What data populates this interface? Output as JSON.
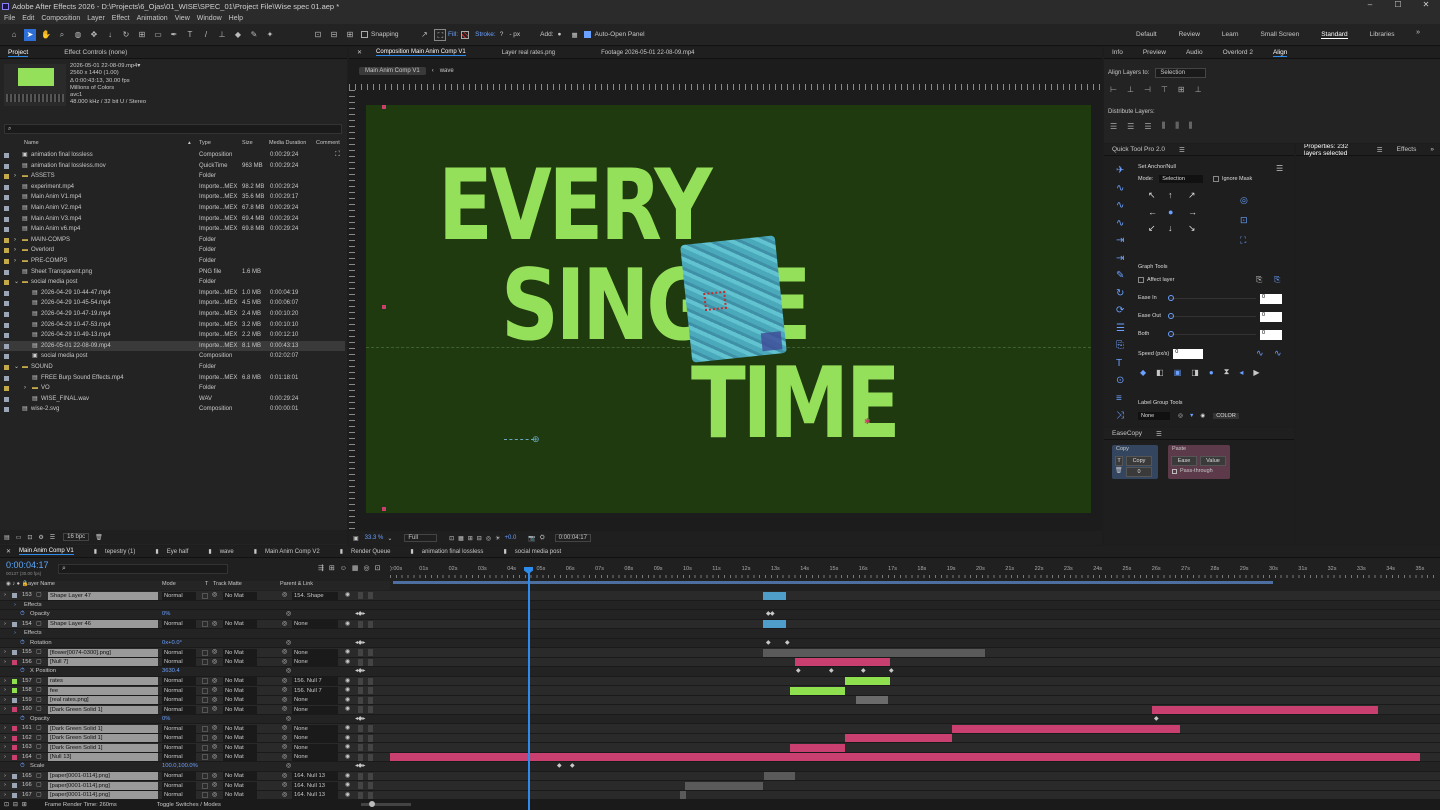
{
  "window": {
    "title": "Adobe After Effects 2026 - D:\\Projects\\6_Ojas\\01_WISE\\SPEC_01\\Project File\\Wise spec 01.aep *",
    "min": "–",
    "max": "☐",
    "close": "✕"
  },
  "menu": [
    "File",
    "Edit",
    "Composition",
    "Layer",
    "Effect",
    "Animation",
    "View",
    "Window",
    "Help"
  ],
  "toolbar": {
    "snapping": "Snapping",
    "fill": "Fill:",
    "stroke": "Stroke:",
    "stroke_px": "- px",
    "add": "Add:",
    "auto_open": "Auto-Open Panel",
    "workspaces": [
      "Default",
      "Review",
      "Learn",
      "Small Screen",
      "Standard",
      "Libraries"
    ],
    "active_workspace": "Standard"
  },
  "project": {
    "tabs": [
      "Project",
      "Effect Controls (none)"
    ],
    "preview": {
      "name": "2026-05-01 22-08-09.mp4▾",
      "res": "2560 x 1440 (1.00)",
      "dur": "Δ 0:00:43:13, 30.00 fps",
      "colors": "Millions of Colors",
      "codec": "avc1",
      "audio": "48.000 kHz / 32 bit U / Stereo"
    },
    "search_placeholder": "",
    "columns": [
      "Name",
      "Type",
      "Size",
      "Media Duration",
      "Comment"
    ],
    "items": [
      {
        "indent": 0,
        "arrow": "",
        "icon": "comp",
        "name": "animation final lossless",
        "type": "Composition",
        "size": "",
        "dur": "0:00:29:24",
        "label": "#9aa6b5"
      },
      {
        "indent": 0,
        "arrow": "",
        "icon": "file",
        "name": "animation final lossless.mov",
        "type": "QuickTime",
        "size": "963 MB",
        "dur": "0:00:29:24",
        "label": "#9aa6b5"
      },
      {
        "indent": 0,
        "arrow": "›",
        "icon": "folder",
        "name": "ASSETS",
        "type": "Folder",
        "size": "",
        "dur": "",
        "label": "#c4a94b"
      },
      {
        "indent": 0,
        "arrow": "",
        "icon": "file",
        "name": "experiment.mp4",
        "type": "Importe...MEX",
        "size": "98.2 MB",
        "dur": "0:00:29:24",
        "label": "#9aa6b5"
      },
      {
        "indent": 0,
        "arrow": "",
        "icon": "file",
        "name": "Main Anim V1.mp4",
        "type": "Importe...MEX",
        "size": "35.6 MB",
        "dur": "0:00:29:17",
        "label": "#9aa6b5"
      },
      {
        "indent": 0,
        "arrow": "",
        "icon": "file",
        "name": "Main Anim V2.mp4",
        "type": "Importe...MEX",
        "size": "67.8 MB",
        "dur": "0:00:29:24",
        "label": "#9aa6b5"
      },
      {
        "indent": 0,
        "arrow": "",
        "icon": "file",
        "name": "Main Anim V3.mp4",
        "type": "Importe...MEX",
        "size": "69.4 MB",
        "dur": "0:00:29:24",
        "label": "#9aa6b5"
      },
      {
        "indent": 0,
        "arrow": "",
        "icon": "file",
        "name": "Main Anim v6.mp4",
        "type": "Importe...MEX",
        "size": "69.8 MB",
        "dur": "0:00:29:24",
        "label": "#9aa6b5"
      },
      {
        "indent": 0,
        "arrow": "›",
        "icon": "folder",
        "name": "MAIN-COMPS",
        "type": "Folder",
        "size": "",
        "dur": "",
        "label": "#c4a94b"
      },
      {
        "indent": 0,
        "arrow": "›",
        "icon": "folder",
        "name": "Overlord",
        "type": "Folder",
        "size": "",
        "dur": "",
        "label": "#c4a94b"
      },
      {
        "indent": 0,
        "arrow": "›",
        "icon": "folder",
        "name": "PRE-COMPS",
        "type": "Folder",
        "size": "",
        "dur": "",
        "label": "#c4a94b"
      },
      {
        "indent": 0,
        "arrow": "",
        "icon": "file",
        "name": "Sheet Transparent.png",
        "type": "PNG file",
        "size": "1.6 MB",
        "dur": "",
        "label": "#9aa6b5"
      },
      {
        "indent": 0,
        "arrow": "⌄",
        "icon": "folder",
        "name": "social media post",
        "type": "Folder",
        "size": "",
        "dur": "",
        "label": "#c4a94b"
      },
      {
        "indent": 1,
        "arrow": "",
        "icon": "file",
        "name": "2026-04-29 10-44-47.mp4",
        "type": "Importe...MEX",
        "size": "1.0 MB",
        "dur": "0:00:04:19",
        "label": "#9aa6b5"
      },
      {
        "indent": 1,
        "arrow": "",
        "icon": "file",
        "name": "2026-04-29 10-45-54.mp4",
        "type": "Importe...MEX",
        "size": "4.5 MB",
        "dur": "0:00:06:07",
        "label": "#9aa6b5"
      },
      {
        "indent": 1,
        "arrow": "",
        "icon": "file",
        "name": "2026-04-29 10-47-19.mp4",
        "type": "Importe...MEX",
        "size": "2.4 MB",
        "dur": "0:00:10:20",
        "label": "#9aa6b5"
      },
      {
        "indent": 1,
        "arrow": "",
        "icon": "file",
        "name": "2026-04-29 10-47-53.mp4",
        "type": "Importe...MEX",
        "size": "3.2 MB",
        "dur": "0:00:10:10",
        "label": "#9aa6b5"
      },
      {
        "indent": 1,
        "arrow": "",
        "icon": "file",
        "name": "2026-04-29 10-49-13.mp4",
        "type": "Importe...MEX",
        "size": "2.2 MB",
        "dur": "0:00:12:10",
        "label": "#9aa6b5"
      },
      {
        "indent": 1,
        "arrow": "",
        "icon": "file",
        "name": "2026-05-01 22-08-09.mp4",
        "type": "Importe...MEX",
        "size": "8.1 MB",
        "dur": "0:00:43:13",
        "label": "#9aa6b5",
        "selected": true
      },
      {
        "indent": 1,
        "arrow": "",
        "icon": "comp",
        "name": "social media post",
        "type": "Composition",
        "size": "",
        "dur": "0:02:02:07",
        "label": "#9aa6b5"
      },
      {
        "indent": 0,
        "arrow": "⌄",
        "icon": "folder",
        "name": "SOUND",
        "type": "Folder",
        "size": "",
        "dur": "",
        "label": "#c4a94b"
      },
      {
        "indent": 1,
        "arrow": "",
        "icon": "file",
        "name": "FREE Burp Sound Effects.mp4",
        "type": "Importe...MEX",
        "size": "6.8 MB",
        "dur": "0:01:18:01",
        "label": "#9aa6b5"
      },
      {
        "indent": 1,
        "arrow": "›",
        "icon": "folder",
        "name": "VO",
        "type": "Folder",
        "size": "",
        "dur": "",
        "label": "#c4a94b"
      },
      {
        "indent": 1,
        "arrow": "",
        "icon": "file",
        "name": "WISE_FINAL.wav",
        "type": "WAV",
        "size": "",
        "dur": "0:00:29:24",
        "label": "#9aa6b5"
      },
      {
        "indent": 0,
        "arrow": "",
        "icon": "file",
        "name": "wise-2.svg",
        "type": "Composition",
        "size": "",
        "dur": "0:00:00:01",
        "label": "#9aa6b5"
      }
    ],
    "bpc": "16 bpc"
  },
  "viewer": {
    "tabs": [
      "Composition Main Anim Comp V1",
      "Layer real rates.png",
      "Footage 2026-05-01 22-08-09.mp4"
    ],
    "crumbs": [
      "Main Anim Comp V1",
      "wave"
    ],
    "words": [
      "EVERY",
      "SINGLE",
      "TIME"
    ],
    "canvas_bg": "#1f3a0e",
    "text_color": "#95e05a",
    "card_color": "#53b8c8",
    "zoom": "33.3 %",
    "quality": "Full",
    "plus": "+0.0",
    "timecode": "0:00:04:17"
  },
  "right": {
    "tabs": [
      "Info",
      "Preview",
      "Audio",
      "Overlord 2",
      "Align"
    ],
    "align_to_label": "Align Layers to:",
    "align_to": "Selection",
    "distribute": "Distribute Layers:",
    "quicktool": {
      "title": "Quick Tool Pro 2.0",
      "set_anchor": "Set Anchor/Null",
      "mode": "Mode:",
      "mode_value": "Selection",
      "ignore_mask": "Ignore Mask",
      "graph_tools": "Graph Tools",
      "affect_layer": "Affect layer",
      "ease_in": "Ease In",
      "ease_out": "Ease Out",
      "both": "Both",
      "speed": "Speed (px/s)",
      "ease_in_val": "0",
      "ease_out_val": "0",
      "both_val": "0",
      "speed_val": "0",
      "label_group": "Label Group Tools",
      "none": "None",
      "color": "COLOR"
    },
    "easecopy": {
      "title": "EaseCopy",
      "copy": "Copy",
      "paste": "Paste",
      "copy_btn": "Copy",
      "ease_btn": "Ease",
      "value_btn": "Value",
      "pass": "Pass-through",
      "t": "T",
      "zero": "0"
    },
    "properties": "Properties: 232 layers selected",
    "effects": "Effects"
  },
  "timeline": {
    "tabs": [
      "Main Anim Comp V1",
      "tepestry (1)",
      "Eye half",
      "wave",
      "Main Anim Comp V2",
      "Render Queue",
      "animation final lossless",
      "social media post"
    ],
    "time": "0:00:04:17",
    "fps": "00137 (30.00 fps)",
    "cols": [
      "Layer Name",
      "Mode",
      "T",
      "Track Matte",
      "Parent & Link"
    ],
    "ruler": [
      "):00s",
      "01s",
      "02s",
      "03s",
      "04s",
      "05s",
      "06s",
      "07s",
      "08s",
      "09s",
      "10s",
      "11s",
      "12s",
      "13s",
      "14s",
      "15s",
      "16s",
      "17s",
      "18s",
      "19s",
      "20s",
      "21s",
      "22s",
      "23s",
      "24s",
      "25s",
      "26s",
      "27s",
      "28s",
      "29s",
      "30s",
      "31s",
      "32s",
      "33s",
      "34s",
      "35s"
    ],
    "rows": [
      {
        "kind": "layer",
        "num": "153",
        "name": "Shape Layer 47",
        "mode": "Normal",
        "matte": "No Mat",
        "parent": "154. Shape",
        "color": "#9aa6b5",
        "bar": null,
        "hl": true
      },
      {
        "kind": "prop",
        "name": "Effects",
        "val": ""
      },
      {
        "kind": "prop2",
        "name": "Opacity",
        "val": "0%"
      },
      {
        "kind": "layer",
        "num": "154",
        "name": "Shape Layer 46",
        "mode": "Normal",
        "matte": "No Mat",
        "parent": "None",
        "color": "#9aa6b5",
        "bar": null,
        "hl": true
      },
      {
        "kind": "prop",
        "name": "Effects",
        "val": ""
      },
      {
        "kind": "prop2",
        "name": "Rotation",
        "val": "0x+0.0°"
      },
      {
        "kind": "layer",
        "num": "155",
        "name": "[flower[0074-0300].png]",
        "mode": "Normal",
        "matte": "No Mat",
        "parent": "None",
        "color": "#9aa6b5",
        "bar": null,
        "hl": true
      },
      {
        "kind": "layer",
        "num": "156",
        "name": "[Null 7]",
        "mode": "Normal",
        "matte": "No Mat",
        "parent": "None",
        "color": "#c93f6f",
        "bar": null,
        "hl": true
      },
      {
        "kind": "prop2",
        "name": "X Position",
        "val": "3630.4"
      },
      {
        "kind": "layer",
        "num": "157",
        "name": "rates",
        "mode": "Normal",
        "matte": "No Mat",
        "parent": "156. Null 7",
        "color": "#8ee04f",
        "bar": null,
        "hl": true
      },
      {
        "kind": "layer",
        "num": "158",
        "name": "fee",
        "mode": "Normal",
        "matte": "No Mat",
        "parent": "156. Null 7",
        "color": "#8ee04f",
        "bar": null,
        "hl": true
      },
      {
        "kind": "layer",
        "num": "159",
        "name": "[real rates.png]",
        "mode": "Normal",
        "matte": "No Mat",
        "parent": "None",
        "color": "#9aa6b5",
        "bar": null,
        "hl": true
      },
      {
        "kind": "layer",
        "num": "160",
        "name": "[Dark Green Solid 1]",
        "mode": "Normal",
        "matte": "No Mat",
        "parent": "None",
        "color": "#c93f6f",
        "bar": null,
        "hl": true
      },
      {
        "kind": "prop2",
        "name": "Opacity",
        "val": "0%"
      },
      {
        "kind": "layer",
        "num": "161",
        "name": "[Dark Green Solid 1]",
        "mode": "Normal",
        "matte": "No Mat",
        "parent": "None",
        "color": "#c93f6f",
        "bar": null,
        "hl": true
      },
      {
        "kind": "layer",
        "num": "162",
        "name": "[Dark Green Solid 1]",
        "mode": "Normal",
        "matte": "No Mat",
        "parent": "None",
        "color": "#c93f6f",
        "bar": null,
        "hl": true
      },
      {
        "kind": "layer",
        "num": "163",
        "name": "[Dark Green Solid 1]",
        "mode": "Normal",
        "matte": "No Mat",
        "parent": "None",
        "color": "#c93f6f",
        "bar": null,
        "hl": true
      },
      {
        "kind": "layer",
        "num": "164",
        "name": "[Null 13]",
        "mode": "Normal",
        "matte": "No Mat",
        "parent": "None",
        "color": "#c93f6f",
        "bar": null,
        "hl": true
      },
      {
        "kind": "prop2",
        "name": "Scale",
        "val": "100.0,100.0%"
      },
      {
        "kind": "layer",
        "num": "165",
        "name": "[paper[0001-0114].png]",
        "mode": "Normal",
        "matte": "No Mat",
        "parent": "164. Null 13",
        "color": "#9aa6b5",
        "bar": null,
        "hl": true
      },
      {
        "kind": "layer",
        "num": "166",
        "name": "[paper[0001-0114].png]",
        "mode": "Normal",
        "matte": "No Mat",
        "parent": "164. Null 13",
        "color": "#9aa6b5",
        "bar": null,
        "hl": true
      },
      {
        "kind": "layer",
        "num": "167",
        "name": "[paper[0001-0114].png]",
        "mode": "Normal",
        "matte": "No Mat",
        "parent": "164. Null 13",
        "color": "#9aa6b5",
        "bar": null,
        "hl": true
      }
    ],
    "footer": {
      "render": "Frame Render Time: 260ms",
      "toggle": "Toggle Switches / Modes"
    }
  }
}
